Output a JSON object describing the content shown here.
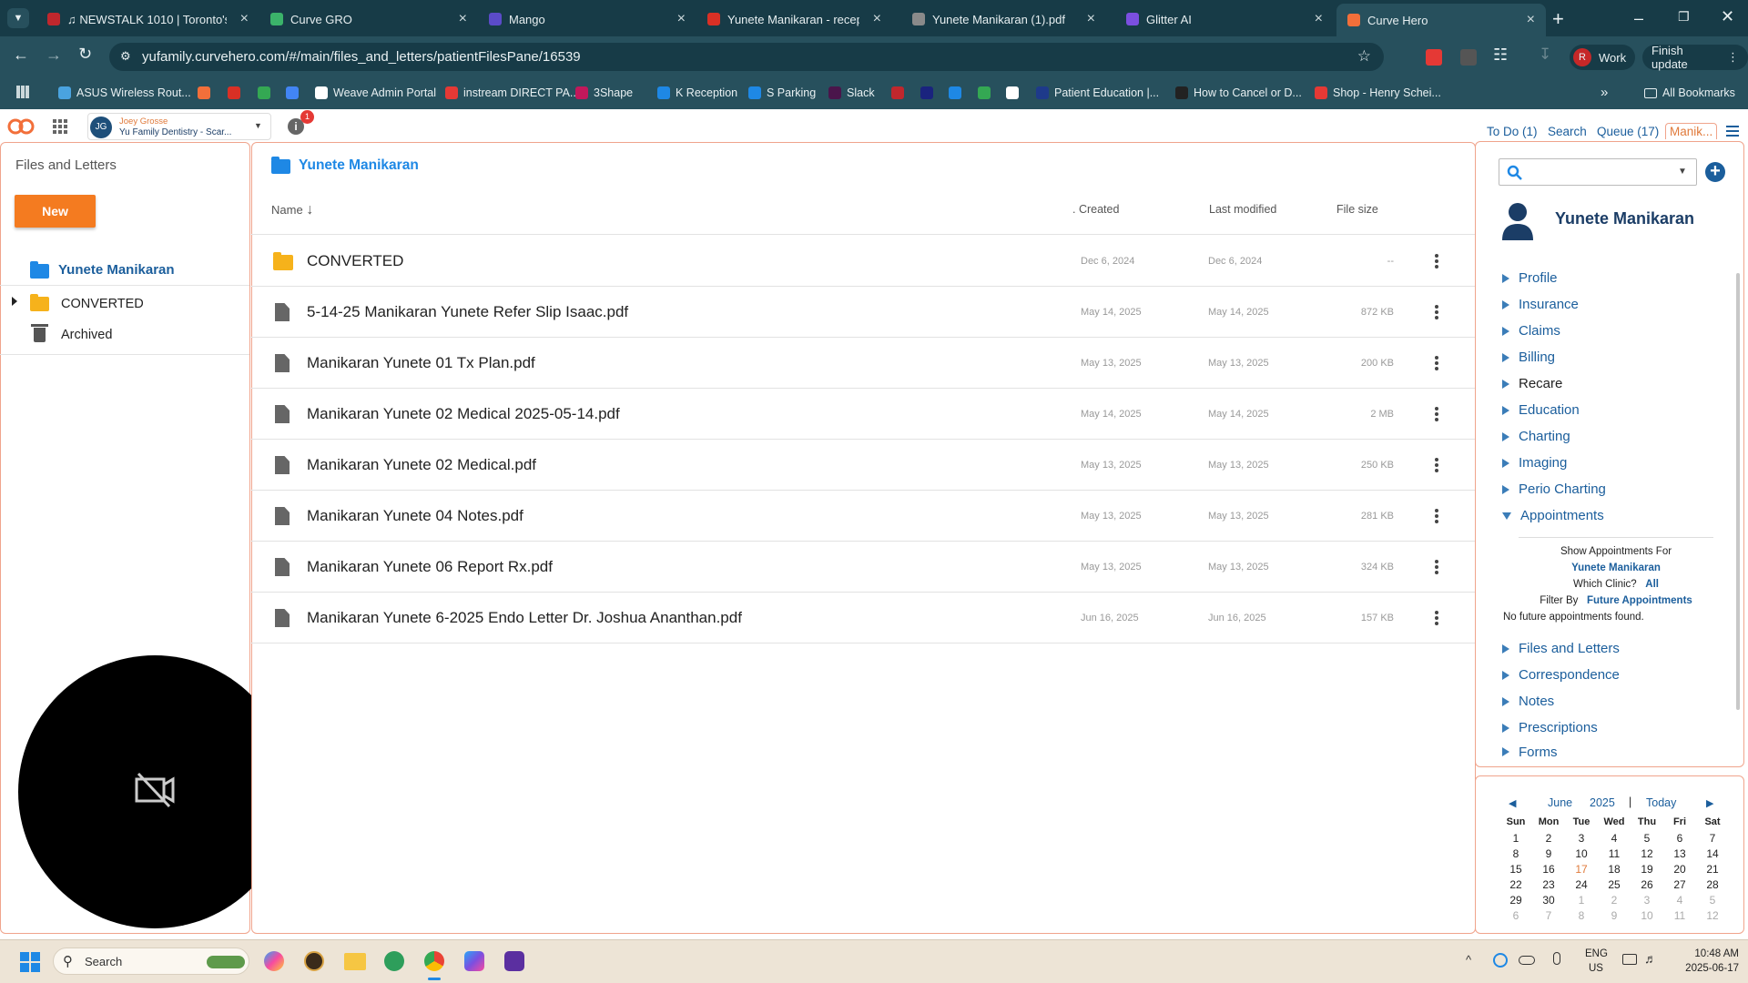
{
  "browser": {
    "tabs": [
      {
        "label": "♫ NEWSTALK 1010 | Toronto's",
        "color": "#c0272d"
      },
      {
        "label": "Curve GRO",
        "color": "#3bb36a"
      },
      {
        "label": "Mango",
        "color": "#5b4bc9"
      },
      {
        "label": "Yunete Manikaran - reception@",
        "color": "#d93025"
      },
      {
        "label": "Yunete Manikaran (1).pdf",
        "color": "#8a8a8a"
      },
      {
        "label": "Glitter AI",
        "color": "#7b4fe0"
      },
      {
        "label": "Curve Hero",
        "color": "#f26f3a"
      }
    ],
    "url": "yufamily.curvehero.com/#/main/files_and_letters/patientFilesPane/16539",
    "profile_label": "Work",
    "profile_initial": "R",
    "finish_update": "Finish update",
    "bookmarks": [
      {
        "label": "ASUS Wireless Rout...",
        "color": "#4aa3df"
      },
      {
        "label": "",
        "color": "#f26f3a"
      },
      {
        "label": "",
        "color": "#d93025"
      },
      {
        "label": "",
        "color": "#34a853"
      },
      {
        "label": "",
        "color": "#4285f4"
      },
      {
        "label": "Weave Admin Portal",
        "color": "#ffffff"
      },
      {
        "label": "instream DIRECT PA...",
        "color": "#e53935"
      },
      {
        "label": "3Shape",
        "color": "#c2185b"
      },
      {
        "label": "K Reception",
        "color": "#1e88e5"
      },
      {
        "label": "S Parking",
        "color": "#1e88e5"
      },
      {
        "label": "Slack",
        "color": "#4a154b"
      },
      {
        "label": "",
        "color": "#c0272d"
      },
      {
        "label": "",
        "color": "#1a237e"
      },
      {
        "label": "",
        "color": "#1e88e5"
      },
      {
        "label": "",
        "color": "#34a853"
      },
      {
        "label": "",
        "color": "#ffffff"
      },
      {
        "label": "Patient Education |...",
        "color": "#1e3a8a"
      },
      {
        "label": "How to Cancel or D...",
        "color": "#222222"
      },
      {
        "label": "Shop - Henry Schei...",
        "color": "#e53935"
      }
    ],
    "all_bookmarks": "All Bookmarks"
  },
  "app": {
    "user": {
      "initials": "JG",
      "name": "Joey Grosse",
      "clinic": "Yu Family Dentistry - Scar..."
    },
    "info_badge": "1",
    "top_links": {
      "todo": "To Do (1)",
      "search": "Search",
      "queue": "Queue (17)",
      "patient_tab": "Manik..."
    }
  },
  "left": {
    "title": "Files and Letters",
    "new_button": "New",
    "root": "Yunete Manikaran",
    "folders": [
      "CONVERTED",
      "Archived"
    ]
  },
  "main": {
    "breadcrumb": "Yunete Manikaran",
    "columns": {
      "name": "Name",
      "created": "Created",
      "modified": "Last modified",
      "size": "File size"
    },
    "rows": [
      {
        "name": "CONVERTED",
        "created": "Dec 6, 2024",
        "modified": "Dec 6, 2024",
        "size": "--",
        "folder": true
      },
      {
        "name": "5-14-25 Manikaran Yunete Refer Slip Isaac.pdf",
        "created": "May 14, 2025",
        "modified": "May 14, 2025",
        "size": "872 KB"
      },
      {
        "name": "Manikaran Yunete 01 Tx Plan.pdf",
        "created": "May 13, 2025",
        "modified": "May 13, 2025",
        "size": "200 KB"
      },
      {
        "name": "Manikaran Yunete 02 Medical 2025-05-14.pdf",
        "created": "May 14, 2025",
        "modified": "May 14, 2025",
        "size": "2 MB"
      },
      {
        "name": "Manikaran Yunete 02 Medical.pdf",
        "created": "May 13, 2025",
        "modified": "May 13, 2025",
        "size": "250 KB"
      },
      {
        "name": "Manikaran Yunete 04 Notes.pdf",
        "created": "May 13, 2025",
        "modified": "May 13, 2025",
        "size": "281 KB"
      },
      {
        "name": "Manikaran Yunete 06 Report Rx.pdf",
        "created": "May 13, 2025",
        "modified": "May 13, 2025",
        "size": "324 KB"
      },
      {
        "name": "Manikaran Yunete 6-2025 Endo Letter Dr. Joshua Ananthan.pdf",
        "created": "Jun 16, 2025",
        "modified": "Jun 16, 2025",
        "size": "157 KB"
      }
    ]
  },
  "right": {
    "patient_name": "Yunete Manikaran",
    "nav": [
      "Profile",
      "Insurance",
      "Claims",
      "Billing",
      "Recare",
      "Education",
      "Charting",
      "Imaging",
      "Perio Charting",
      "Appointments"
    ],
    "appointments": {
      "show_for_label": "Show Appointments For",
      "show_for_value": "Yunete Manikaran",
      "clinic_label": "Which Clinic?",
      "clinic_value": "All",
      "filter_label": "Filter By",
      "filter_value": "Future Appointments",
      "empty": "No future appointments found."
    },
    "nav2": [
      "Files and Letters",
      "Correspondence",
      "Notes",
      "Prescriptions",
      "Forms"
    ]
  },
  "calendar": {
    "month": "June",
    "year": "2025",
    "today_label": "Today",
    "weekdays": [
      "Sun",
      "Mon",
      "Tue",
      "Wed",
      "Thu",
      "Fri",
      "Sat"
    ],
    "weeks": [
      [
        "1",
        "2",
        "3",
        "4",
        "5",
        "6",
        "7"
      ],
      [
        "8",
        "9",
        "10",
        "11",
        "12",
        "13",
        "14"
      ],
      [
        "15",
        "16",
        "17",
        "18",
        "19",
        "20",
        "21"
      ],
      [
        "22",
        "23",
        "24",
        "25",
        "26",
        "27",
        "28"
      ],
      [
        "29",
        "30",
        "1",
        "2",
        "3",
        "4",
        "5"
      ],
      [
        "6",
        "7",
        "8",
        "9",
        "10",
        "11",
        "12"
      ]
    ],
    "today": "17"
  },
  "taskbar": {
    "search": "Search",
    "lang": "ENG",
    "region": "US",
    "time": "10:48 AM",
    "date": "2025-06-17"
  }
}
